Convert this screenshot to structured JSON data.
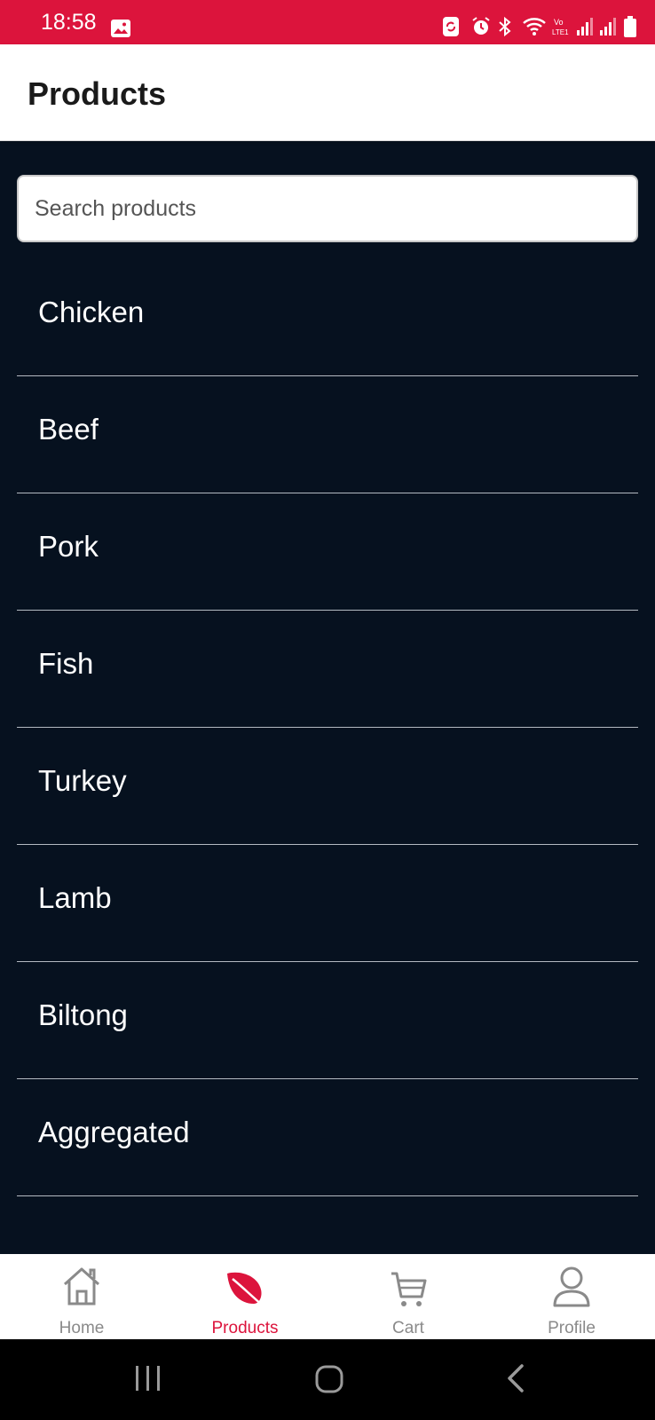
{
  "status_bar": {
    "time": "18:58",
    "background": "#dc143c",
    "right_icons": [
      "sync-icon",
      "alarm-icon",
      "bluetooth-icon",
      "wifi-icon",
      "volte-icon",
      "signal-icon",
      "signal-icon-2",
      "battery-icon"
    ]
  },
  "app_bar": {
    "title": "Products"
  },
  "search": {
    "placeholder": "Search products",
    "value": ""
  },
  "products": [
    {
      "label": "Chicken"
    },
    {
      "label": "Beef"
    },
    {
      "label": "Pork"
    },
    {
      "label": "Fish"
    },
    {
      "label": "Turkey"
    },
    {
      "label": "Lamb"
    },
    {
      "label": "Biltong"
    },
    {
      "label": "Aggregated"
    }
  ],
  "bottom_nav": {
    "items": [
      {
        "label": "Home",
        "icon": "home-icon",
        "active": false
      },
      {
        "label": "Products",
        "icon": "leaf-icon",
        "active": true
      },
      {
        "label": "Cart",
        "icon": "cart-icon",
        "active": false
      },
      {
        "label": "Profile",
        "icon": "profile-icon",
        "active": false
      }
    ],
    "active_color": "#dc143c",
    "inactive_color": "#8a8a8a"
  },
  "system_nav": {
    "buttons": [
      "recents-icon",
      "home-circle-icon",
      "back-icon"
    ]
  },
  "colors": {
    "background": "#06111f",
    "accent": "#dc143c"
  }
}
